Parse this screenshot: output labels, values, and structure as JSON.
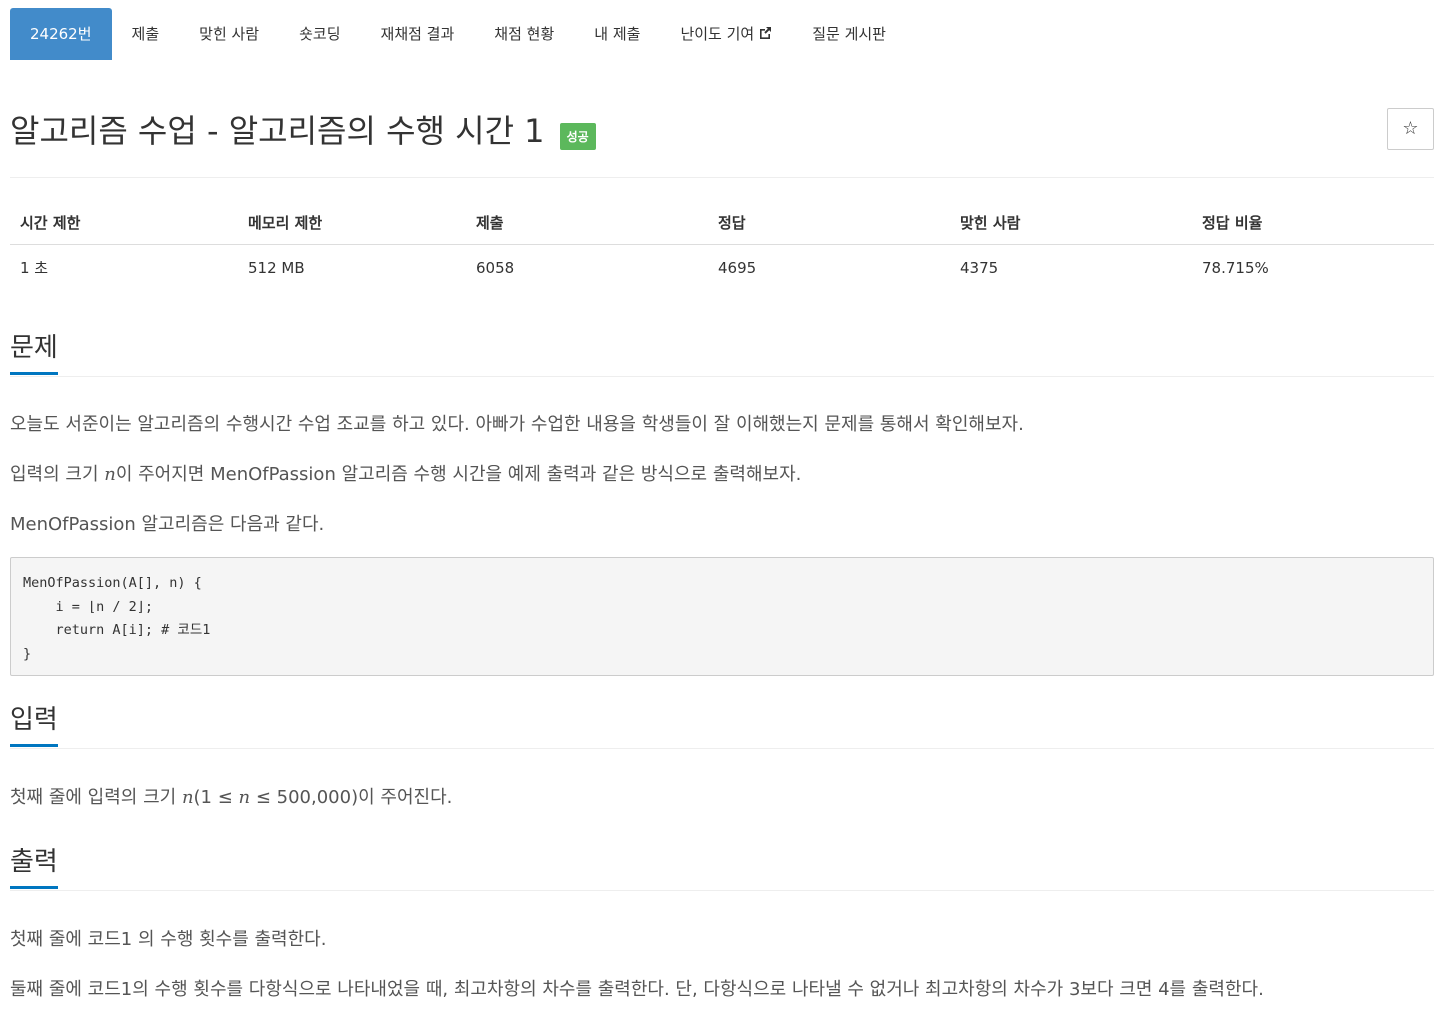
{
  "nav": {
    "tabs": [
      {
        "label": "24262번",
        "active": true
      },
      {
        "label": "제출"
      },
      {
        "label": "맞힌 사람"
      },
      {
        "label": "숏코딩"
      },
      {
        "label": "재채점 결과"
      },
      {
        "label": "채점 현황"
      },
      {
        "label": "내 제출"
      },
      {
        "label": "난이도 기여",
        "icon": "external-link-icon"
      },
      {
        "label": "질문 게시판"
      }
    ]
  },
  "problem": {
    "title": "알고리즘 수업 - 알고리즘의 수행 시간 1",
    "status_badge": "성공",
    "star_icon": "☆"
  },
  "stats": {
    "headers": [
      "시간 제한",
      "메모리 제한",
      "제출",
      "정답",
      "맞힌 사람",
      "정답 비율"
    ],
    "values": [
      "1 초",
      "512 MB",
      "6058",
      "4695",
      "4375",
      "78.715%"
    ]
  },
  "sections": {
    "problem_heading": "문제",
    "input_heading": "입력",
    "output_heading": "출력"
  },
  "description": {
    "p1": "오늘도 서준이는 알고리즘의 수행시간 수업 조교를 하고 있다. 아빠가 수업한 내용을 학생들이 잘 이해했는지 문제를 통해서 확인해보자.",
    "p2_before": "입력의 크기 ",
    "p2_var": "n",
    "p2_after": "이 주어지면 MenOfPassion 알고리즘 수행 시간을 예제 출력과 같은 방식으로 출력해보자.",
    "p3": "MenOfPassion 알고리즘은 다음과 같다.",
    "code": [
      "MenOfPassion(A[], n) {",
      "    i = ⌊n / 2⌋;",
      "    return A[i]; # 코드1",
      "}"
    ]
  },
  "input": {
    "before": "첫째 줄에 입력의 크기 ",
    "var1": "n",
    "middle": "(1 ≤ ",
    "var2": "n",
    "after": " ≤ 500,000)이 주어진다."
  },
  "output": {
    "p1": "첫째 줄에 코드1 의 수행 횟수를 출력한다.",
    "p2": "둘째 줄에 코드1의 수행 횟수를 다항식으로 나타내었을 때, 최고차항의 차수를 출력한다. 단, 다항식으로 나타낼 수 없거나 최고차항의 차수가 3보다 크면 4를 출력한다."
  },
  "colors": {
    "nav_active": "#428bca",
    "badge_success": "#5cb85c",
    "heading_underline": "#0076c0"
  }
}
